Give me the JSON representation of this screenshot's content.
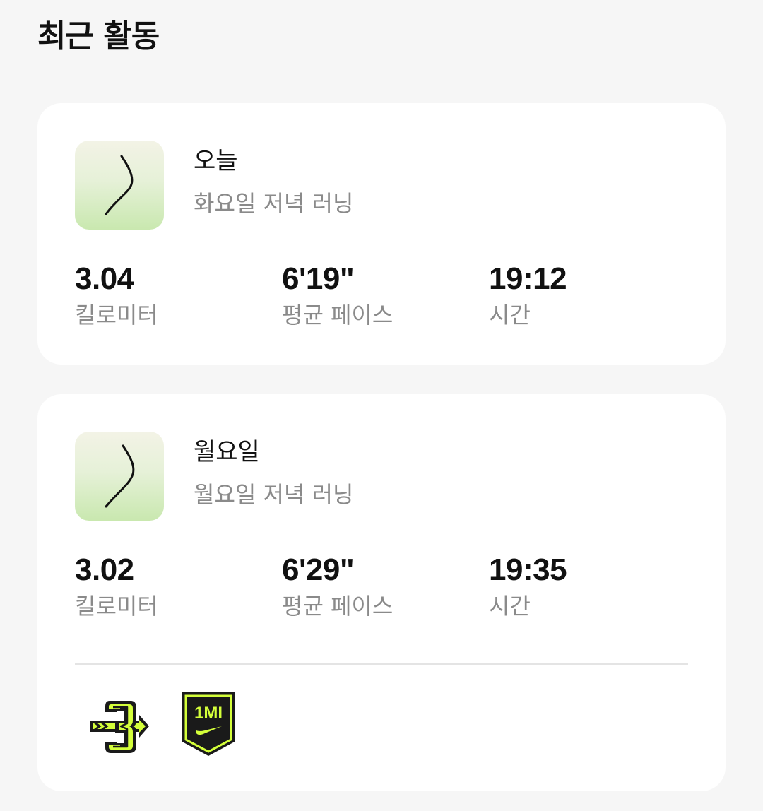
{
  "header": {
    "title": "최근 활동"
  },
  "activities": [
    {
      "day": "오늘",
      "name": "화요일 저녁 러닝",
      "stats": [
        {
          "value": "3.04",
          "label": "킬로미터"
        },
        {
          "value": "6'19\"",
          "label": "평균 페이스"
        },
        {
          "value": "19:12",
          "label": "시간"
        }
      ],
      "thumbnail_icon": "route-map-icon"
    },
    {
      "day": "월요일",
      "name": "월요일 저녁 러닝",
      "stats": [
        {
          "value": "3.02",
          "label": "킬로미터"
        },
        {
          "value": "6'29\"",
          "label": "평균 페이스"
        },
        {
          "value": "19:35",
          "label": "시간"
        }
      ],
      "thumbnail_icon": "route-map-icon",
      "badges": [
        {
          "icon": "three-runs-badge-icon",
          "text": "3"
        },
        {
          "icon": "one-mile-badge-icon",
          "text": "1MI"
        }
      ]
    }
  ],
  "colors": {
    "accent_volt": "#d4ff3a",
    "badge_dark": "#1a1a1a",
    "label_gray": "#8a8a8a",
    "background": "#f6f6f6"
  }
}
